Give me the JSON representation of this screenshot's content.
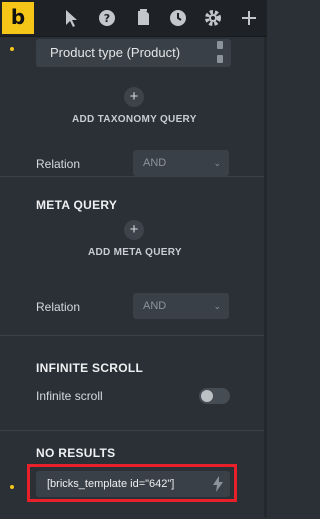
{
  "toolbar": {
    "logo": "b",
    "icons": [
      "pointer-icon",
      "help-icon",
      "pages-icon",
      "history-icon",
      "settings-icon",
      "add-icon"
    ]
  },
  "query": {
    "chip_label": "Product type (Product)",
    "add_taxonomy_label": "ADD TAXONOMY QUERY",
    "relation_label": "Relation",
    "relation_value": "AND"
  },
  "meta_query": {
    "title": "META QUERY",
    "add_label": "ADD META QUERY",
    "relation_label": "Relation",
    "relation_value": "AND"
  },
  "infinite_scroll": {
    "title": "INFINITE SCROLL",
    "label": "Infinite scroll",
    "enabled": false
  },
  "no_results": {
    "title": "NO RESULTS",
    "value": "[bricks_template id=\"642\"]"
  },
  "colors": {
    "accent": "#f5c518",
    "highlight": "#e8202a",
    "panel": "#2b3036",
    "field": "#3a4047"
  }
}
